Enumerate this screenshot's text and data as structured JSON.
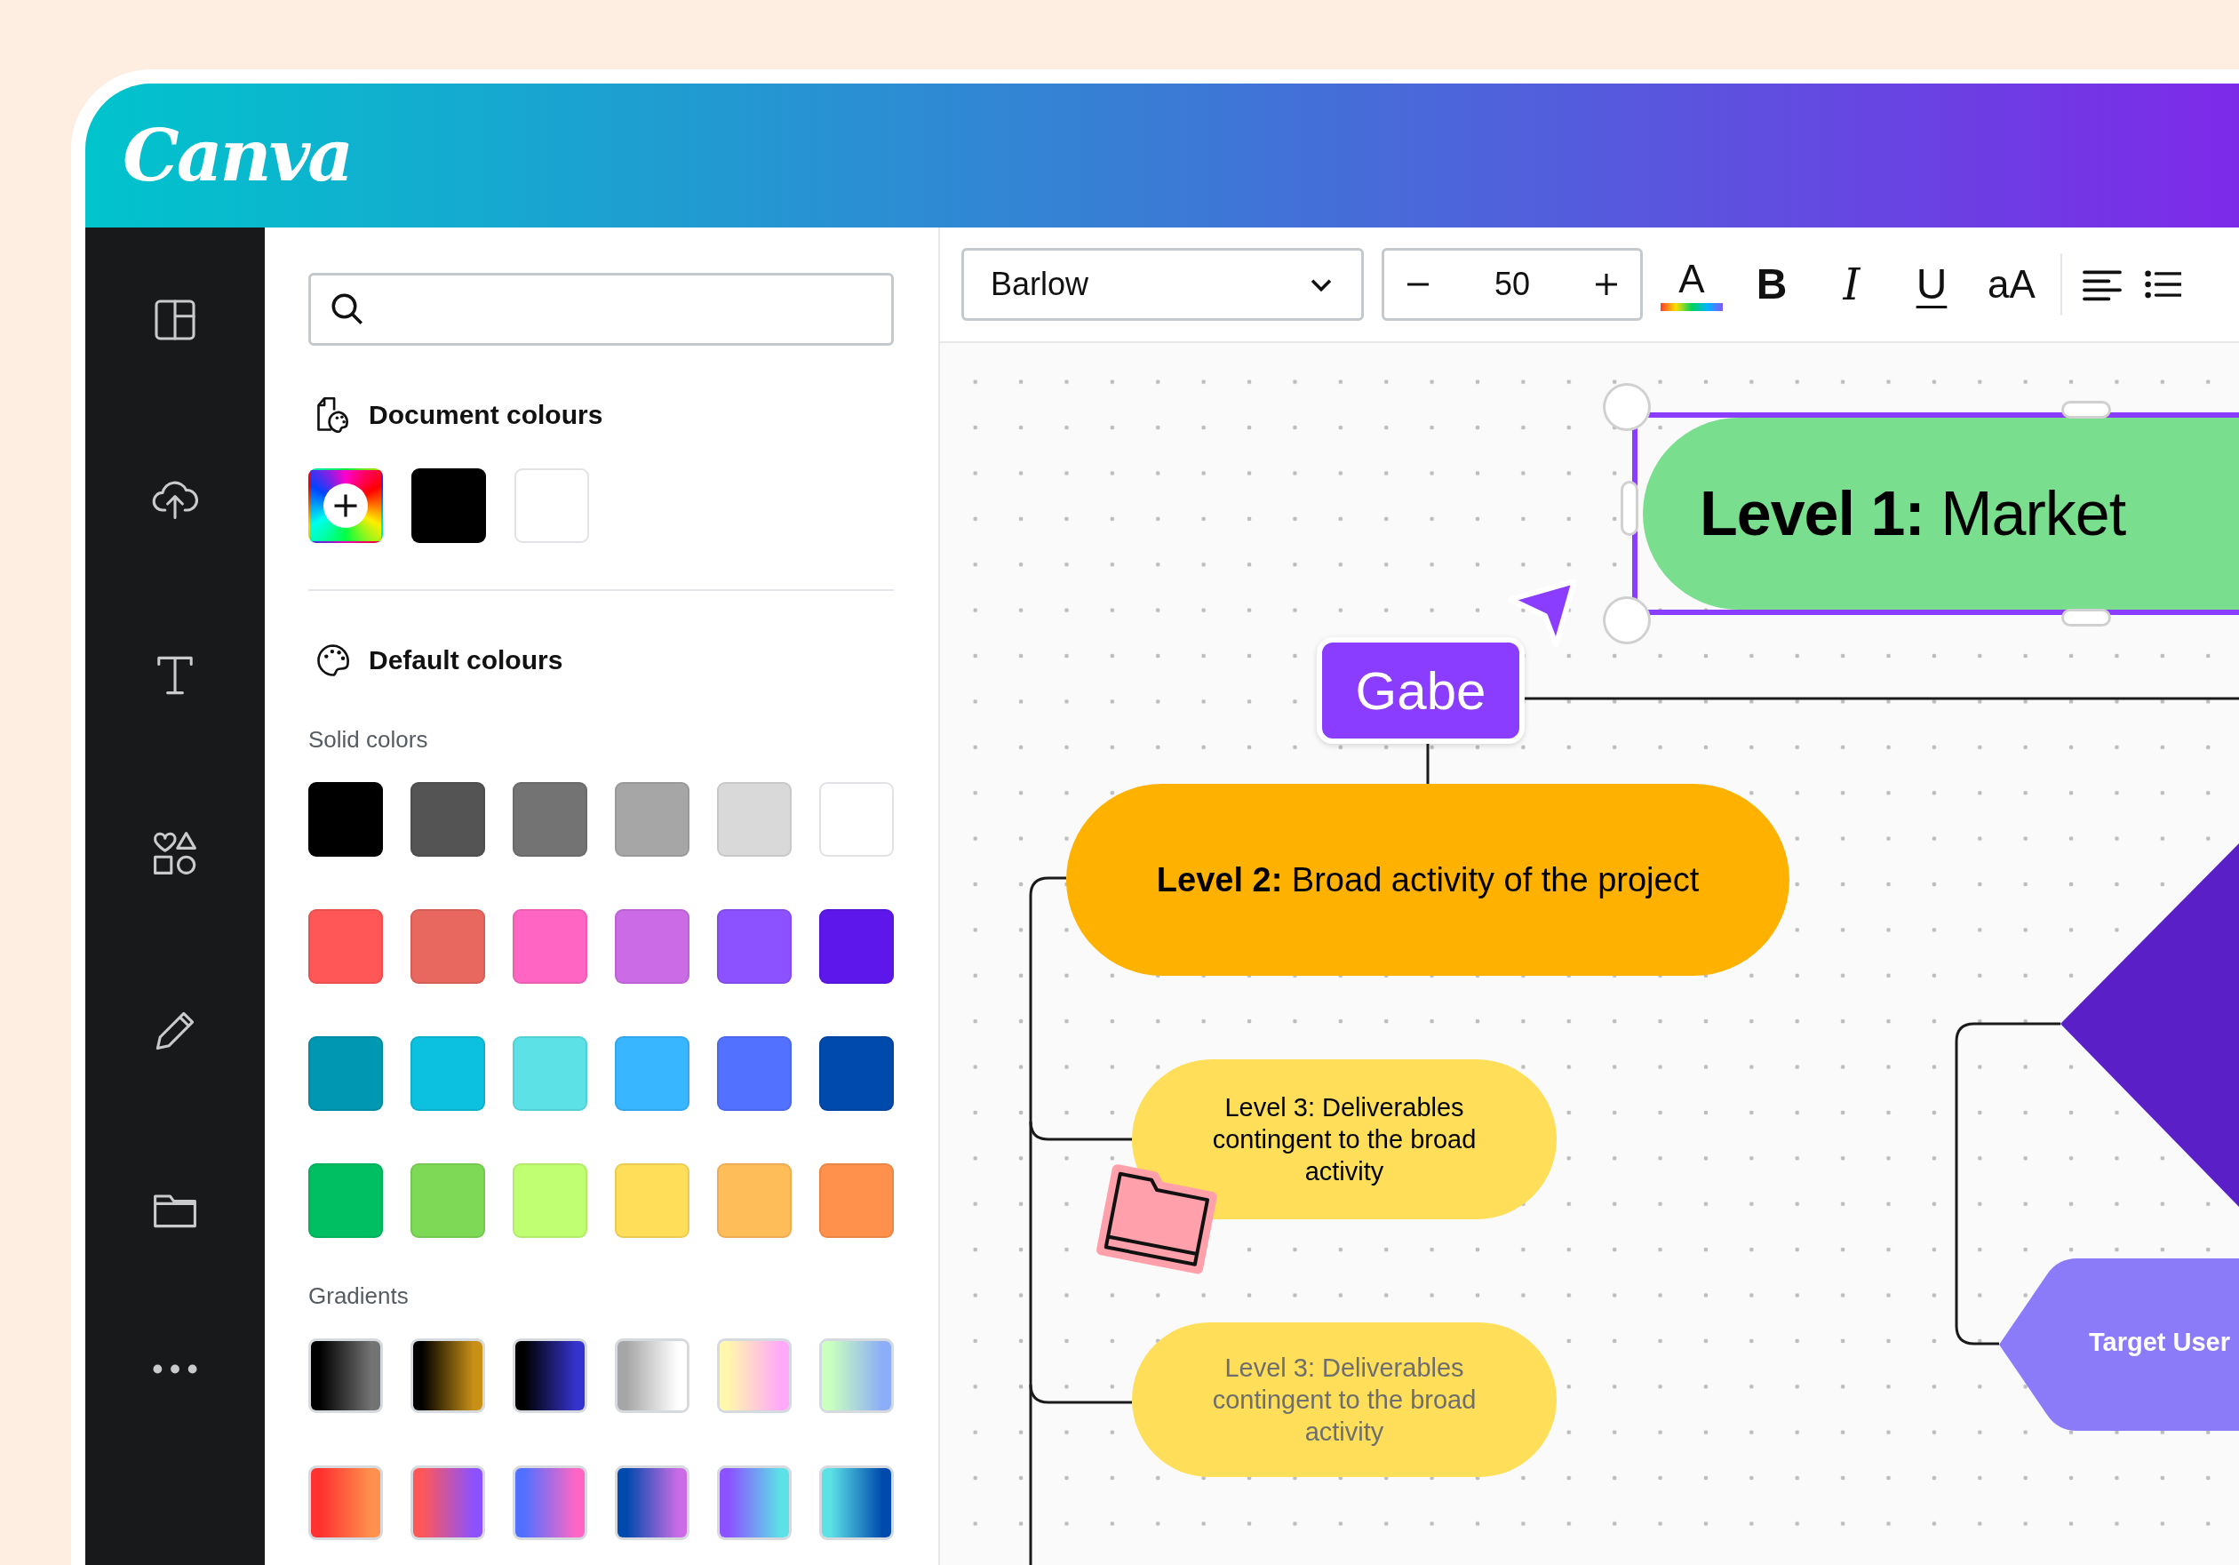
{
  "header": {
    "logo": "Canva"
  },
  "color_panel": {
    "document_colours": {
      "title": "Document colours",
      "swatches": [
        {
          "kind": "add"
        },
        {
          "kind": "solid",
          "color": "#000000"
        },
        {
          "kind": "solid",
          "color": "#ffffff"
        }
      ]
    },
    "default_colours": {
      "title": "Default colours",
      "solid_label": "Solid colors",
      "solid": [
        {
          "color": "#000000"
        },
        {
          "color": "#545454"
        },
        {
          "color": "#737373"
        },
        {
          "color": "#a6a6a6"
        },
        {
          "color": "#d9d9d9"
        },
        {
          "color": "#ffffff"
        },
        {
          "color": "#ff5757"
        },
        {
          "color": "#e8675f"
        },
        {
          "color": "#ff66c4"
        },
        {
          "color": "#cb6ce6"
        },
        {
          "color": "#8c52ff"
        },
        {
          "color": "#5e17eb"
        },
        {
          "color": "#0097b2"
        },
        {
          "color": "#0cc0df"
        },
        {
          "color": "#5ce1e6"
        },
        {
          "color": "#38b6ff"
        },
        {
          "color": "#5271ff"
        },
        {
          "color": "#004aad"
        },
        {
          "color": "#00bf63"
        },
        {
          "color": "#7ed957"
        },
        {
          "color": "#c1ff72"
        },
        {
          "color": "#ffde59"
        },
        {
          "color": "#ffbd59"
        },
        {
          "color": "#ff914d"
        }
      ],
      "gradients_label": "Gradients",
      "gradients": [
        {
          "stops": [
            {
              "color": "#000000"
            },
            {
              "color": "#737373"
            }
          ]
        },
        {
          "stops": [
            {
              "color": "#000000"
            },
            {
              "color": "#c89116"
            }
          ]
        },
        {
          "stops": [
            {
              "color": "#000000"
            },
            {
              "color": "#3533cd"
            }
          ]
        },
        {
          "stops": [
            {
              "color": "#a6a6a6"
            },
            {
              "color": "#ffffff"
            }
          ]
        },
        {
          "stops": [
            {
              "color": "#fff7ad"
            },
            {
              "color": "#ffa9f9"
            }
          ]
        },
        {
          "stops": [
            {
              "color": "#c9ffbf"
            },
            {
              "color": "#8cadf8"
            }
          ]
        },
        {
          "stops": [
            {
              "color": "#ff3131"
            },
            {
              "color": "#ff914d"
            }
          ]
        },
        {
          "stops": [
            {
              "color": "#ff5757"
            },
            {
              "color": "#8c52ff"
            }
          ]
        },
        {
          "stops": [
            {
              "color": "#5170ff"
            },
            {
              "color": "#ff66c4"
            }
          ]
        },
        {
          "stops": [
            {
              "color": "#004aad"
            },
            {
              "color": "#cb6ce6"
            }
          ]
        },
        {
          "stops": [
            {
              "color": "#8c52ff"
            },
            {
              "color": "#5ce1e6"
            }
          ]
        },
        {
          "stops": [
            {
              "color": "#5ce1e6"
            },
            {
              "color": "#004aad"
            }
          ]
        }
      ]
    }
  },
  "toolbar": {
    "font": "Barlow",
    "font_size": "50",
    "format": [
      {
        "kind": "text_color",
        "label": "A"
      },
      {
        "kind": "bold",
        "label": "B"
      },
      {
        "kind": "italic",
        "label": "I"
      },
      {
        "kind": "underline",
        "label": "U"
      },
      {
        "kind": "case",
        "label": "aA"
      }
    ]
  },
  "canvas": {
    "level_1": {
      "text": "**Level 1:** Market",
      "selected": true
    },
    "collaborator": {
      "name": "Gabe"
    },
    "level_2": {
      "text": "**Level 2:** Broad activity of the project"
    },
    "level_3": [
      {
        "text": "Level 3: Deliverables contingent to the broad activity",
        "faded": false
      },
      {
        "text": "Level 3: Deliverables contingent to the broad activity",
        "faded": true
      }
    ],
    "target": {
      "text": "Target User"
    }
  }
}
